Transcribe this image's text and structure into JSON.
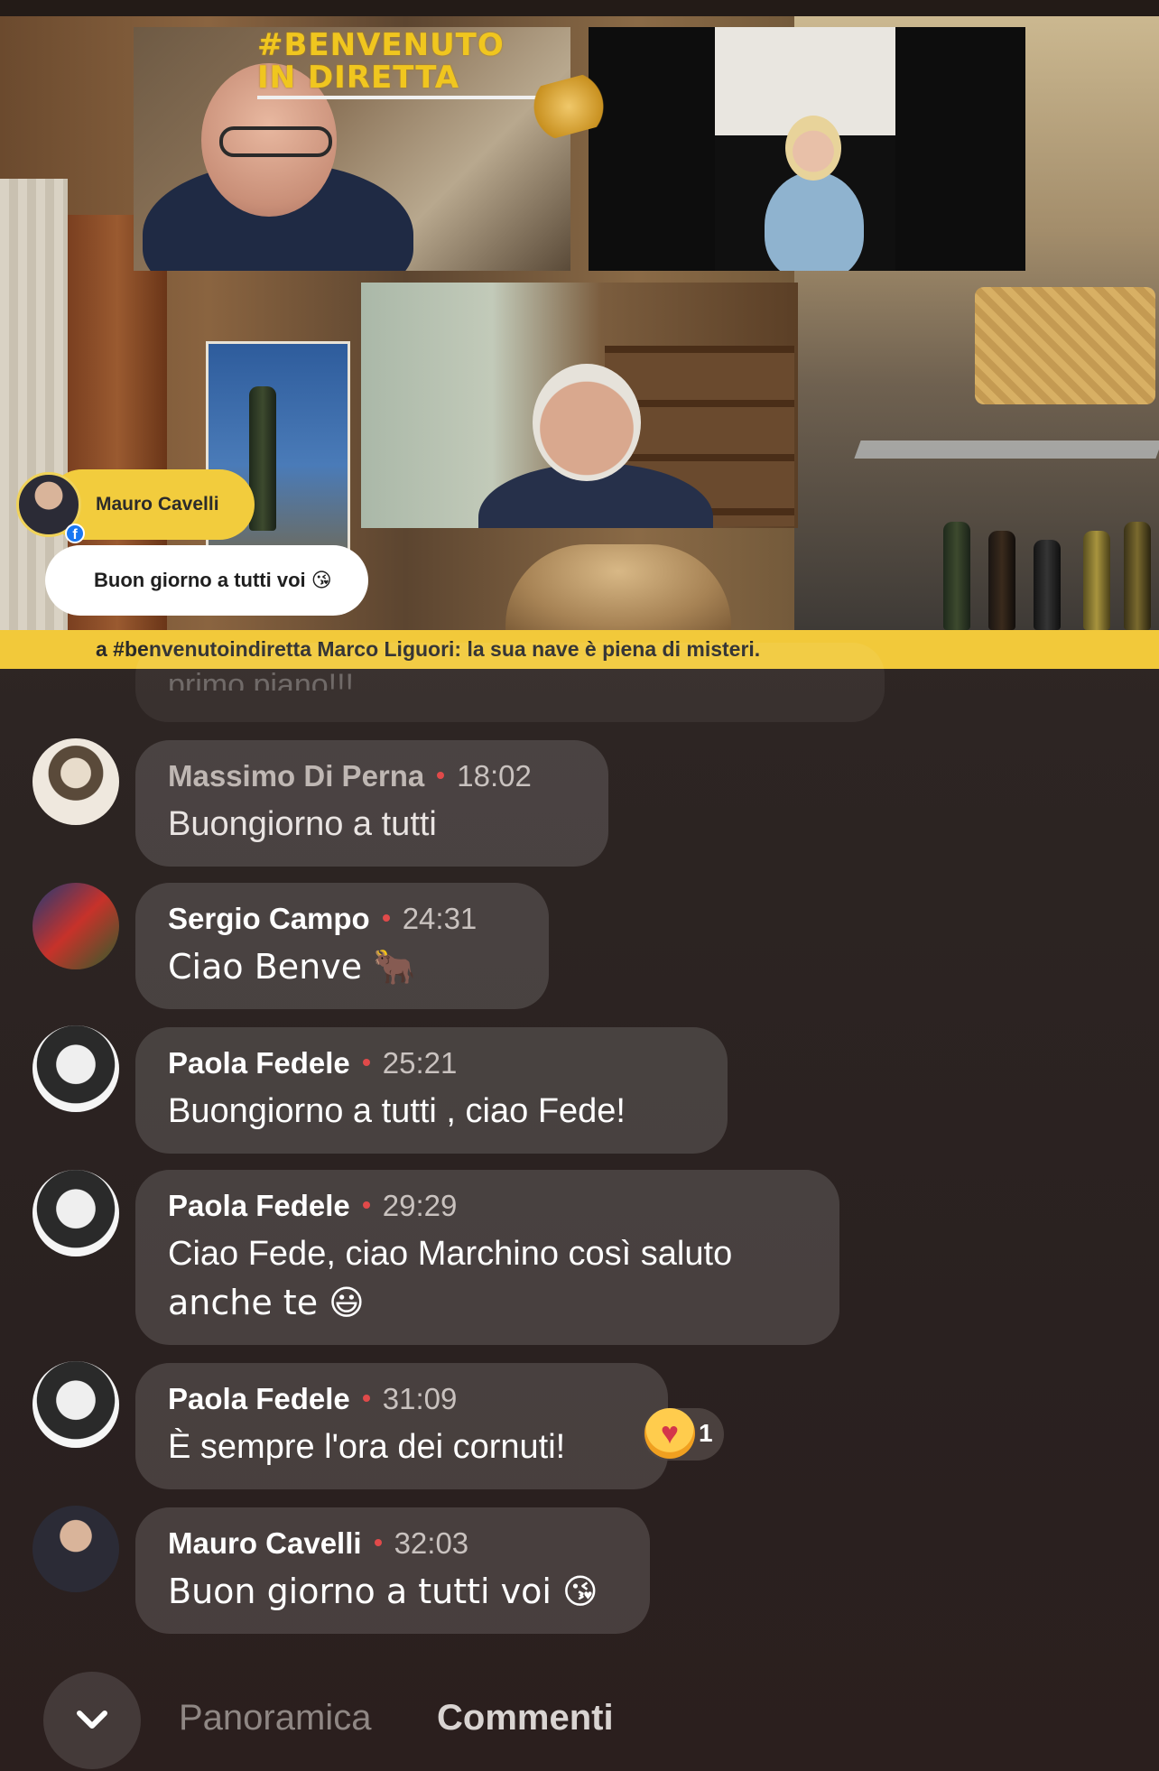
{
  "stream": {
    "logo_line1": "#BENVENUTO",
    "logo_line2": "IN DIRETTA",
    "overlay_comment": {
      "author": "Mauro Cavelli",
      "text": "Buon giorno a tutti voi 😘"
    },
    "ticker": "a #benvenutoindiretta Marco Liguori: la sua nave è piena di misteri."
  },
  "comments": {
    "faded_partial": "primo piano!!!",
    "items": [
      {
        "author": "Massimo Di Perna",
        "time": "18:02",
        "text": "Buongiorno a tutti"
      },
      {
        "author": "Sergio Campo",
        "time": "24:31",
        "text": "Ciao Benve 🐂"
      },
      {
        "author": "Paola Fedele",
        "time": "25:21",
        "text": "Buongiorno a tutti , ciao Fede!"
      },
      {
        "author": "Paola Fedele",
        "time": "29:29",
        "text_line1": "Ciao Fede, ciao Marchino così saluto",
        "text_line2": "anche te 😃"
      },
      {
        "author": "Paola Fedele",
        "time": "31:09",
        "text": "È  sempre l'ora dei cornuti!",
        "reaction": {
          "icon": "care-reaction-icon",
          "count": "1"
        }
      },
      {
        "author": "Mauro Cavelli",
        "time": "32:03",
        "text": "Buon giorno a tutti voi 😘"
      }
    ]
  },
  "tabs": {
    "overview": "Panoramica",
    "comments": "Commenti"
  },
  "colors": {
    "accent_yellow": "#f2c93a",
    "separator_dot": "#e04a4a"
  }
}
